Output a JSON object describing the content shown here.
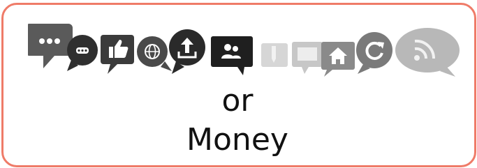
{
  "text": {
    "line1": "or",
    "line2": "Money"
  },
  "colors": {
    "border": "#ef7b68",
    "dark_gray": "#3d3d3d",
    "mid_gray": "#6e6e6e",
    "light_gray": "#b5b5b5",
    "pale_gray": "#d6d6d6"
  },
  "icons": [
    "chat-bubble-icon",
    "ellipsis-bubble-icon",
    "thumbs-up-icon",
    "globe-icon",
    "upload-icon",
    "users-icon",
    "pencil-icon",
    "envelope-icon",
    "home-icon",
    "refresh-icon",
    "rss-icon"
  ]
}
